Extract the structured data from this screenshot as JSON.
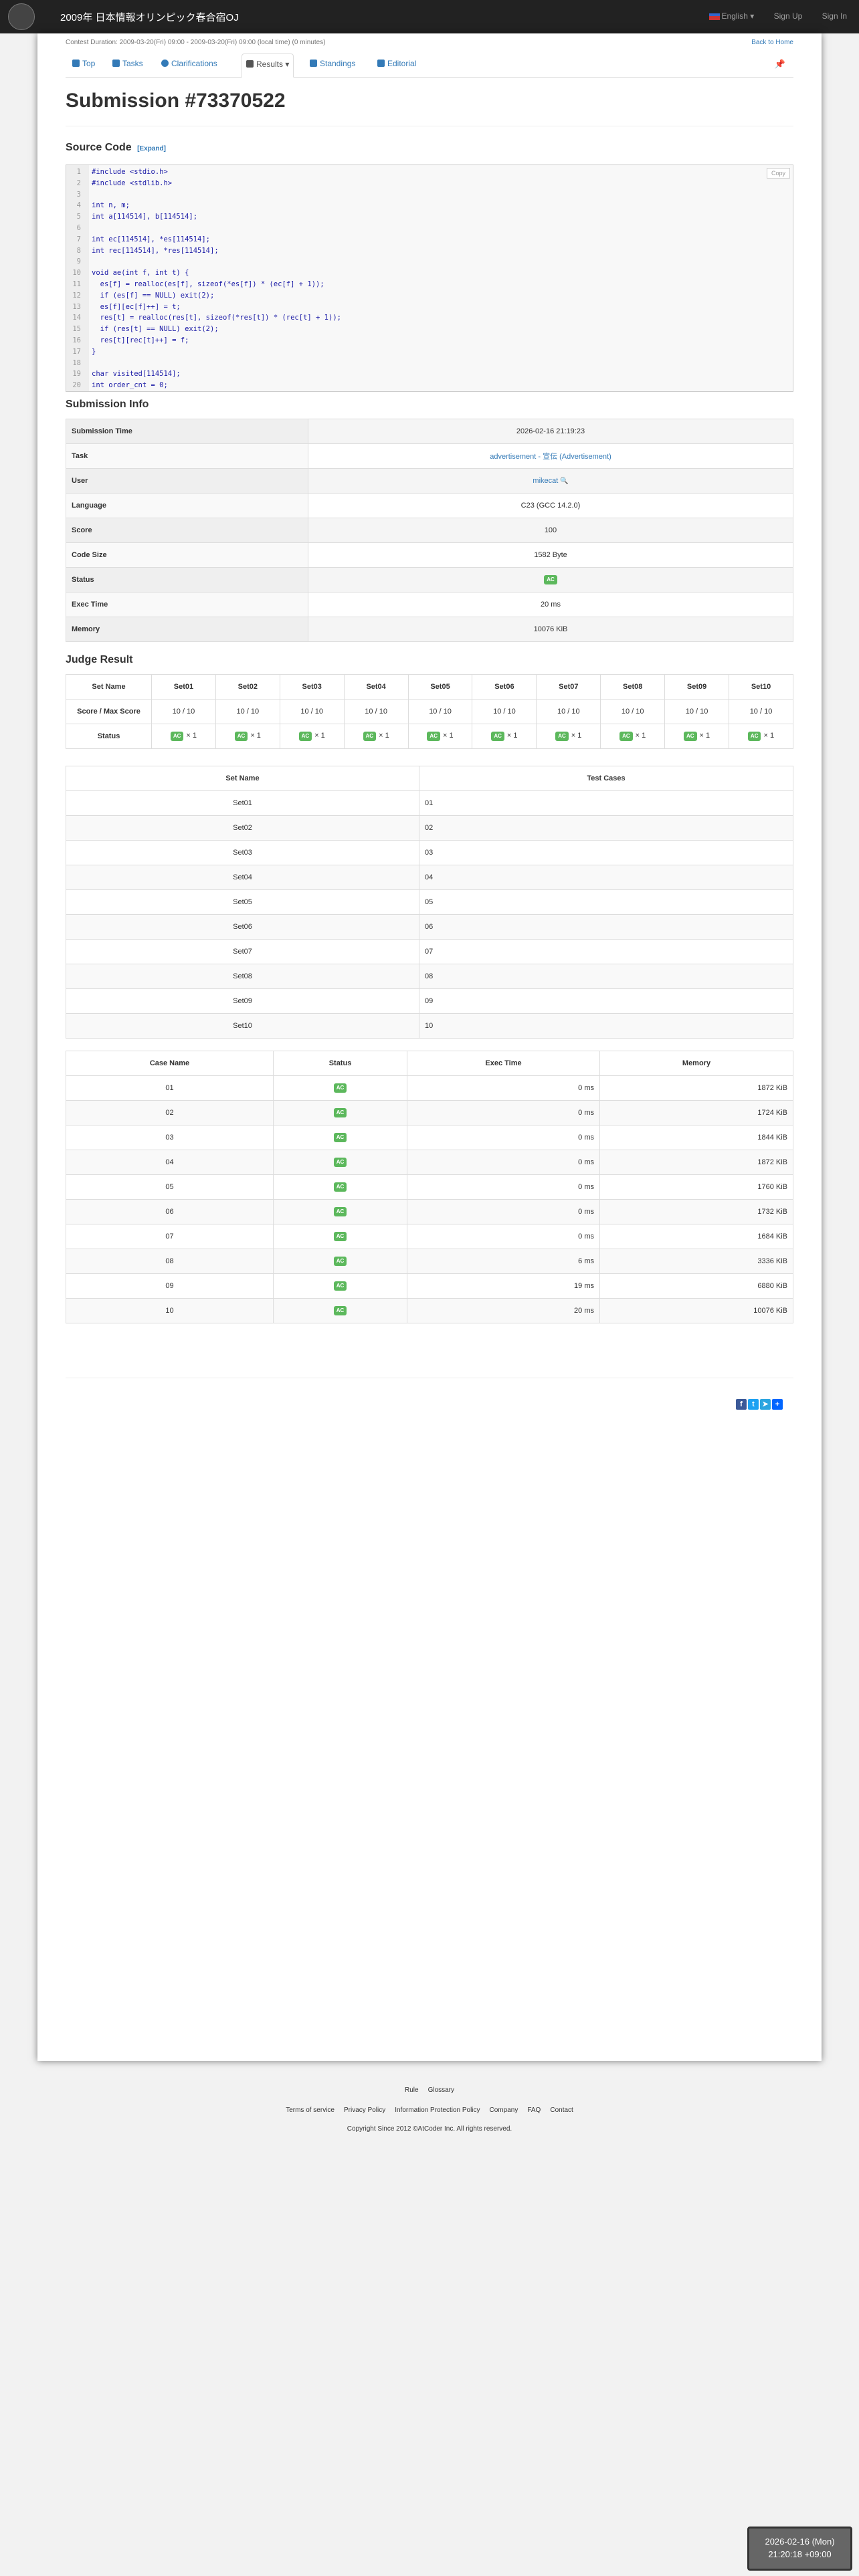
{
  "header": {
    "contest_name": "2009年 日本情報オリンピック春合宿OJ",
    "language": "English",
    "signup": "Sign Up",
    "signin": "Sign In"
  },
  "contest": {
    "duration": "Contest Duration: 2009-03-20(Fri) 09:00 - 2009-03-20(Fri) 09:00 (local time) (0 minutes)",
    "back_home": "Back to Home"
  },
  "nav": {
    "top": "Top",
    "tasks": "Tasks",
    "clarifications": "Clarifications",
    "results": "Results",
    "standings": "Standings",
    "editorial": "Editorial"
  },
  "page_title": "Submission #73370522",
  "source": {
    "heading": "Source Code",
    "expand": "[Expand]",
    "copy": "Copy",
    "lines": [
      "#include <stdio.h>",
      "#include <stdlib.h>",
      "",
      "int n, m;",
      "int a[114514], b[114514];",
      "",
      "int ec[114514], *es[114514];",
      "int rec[114514], *res[114514];",
      "",
      "void ae(int f, int t) {",
      "  es[f] = realloc(es[f], sizeof(*es[f]) * (ec[f] + 1));",
      "  if (es[f] == NULL) exit(2);",
      "  es[f][ec[f]++] = t;",
      "  res[t] = realloc(res[t], sizeof(*res[t]) * (rec[t] + 1));",
      "  if (res[t] == NULL) exit(2);",
      "  res[t][rec[t]++] = f;",
      "}",
      "",
      "char visited[114514];",
      "int order_cnt = 0;"
    ]
  },
  "info": {
    "heading": "Submission Info",
    "rows": [
      {
        "label": "Submission Time",
        "value": "2026-02-16 21:19:23"
      },
      {
        "label": "Task",
        "value": "advertisement - 宣伝 (Advertisement)"
      },
      {
        "label": "User",
        "value": "mikecat"
      },
      {
        "label": "Language",
        "value": "C23 (GCC 14.2.0)"
      },
      {
        "label": "Score",
        "value": "100"
      },
      {
        "label": "Code Size",
        "value": "1582 Byte"
      },
      {
        "label": "Status",
        "value": "AC"
      },
      {
        "label": "Exec Time",
        "value": "20 ms"
      },
      {
        "label": "Memory",
        "value": "10076 KiB"
      }
    ]
  },
  "judge": {
    "heading": "Judge Result",
    "set_name_label": "Set Name",
    "score_label": "Score / Max Score",
    "status_label": "Status",
    "sets": [
      {
        "name": "Set01",
        "score": "10 / 10",
        "status": "AC",
        "count": "× 1"
      },
      {
        "name": "Set02",
        "score": "10 / 10",
        "status": "AC",
        "count": "× 1"
      },
      {
        "name": "Set03",
        "score": "10 / 10",
        "status": "AC",
        "count": "× 1"
      },
      {
        "name": "Set04",
        "score": "10 / 10",
        "status": "AC",
        "count": "× 1"
      },
      {
        "name": "Set05",
        "score": "10 / 10",
        "status": "AC",
        "count": "× 1"
      },
      {
        "name": "Set06",
        "score": "10 / 10",
        "status": "AC",
        "count": "× 1"
      },
      {
        "name": "Set07",
        "score": "10 / 10",
        "status": "AC",
        "count": "× 1"
      },
      {
        "name": "Set08",
        "score": "10 / 10",
        "status": "AC",
        "count": "× 1"
      },
      {
        "name": "Set09",
        "score": "10 / 10",
        "status": "AC",
        "count": "× 1"
      },
      {
        "name": "Set10",
        "score": "10 / 10",
        "status": "AC",
        "count": "× 1"
      }
    ]
  },
  "set_cases": {
    "headers": [
      "Set Name",
      "Test Cases"
    ],
    "rows": [
      [
        "Set01",
        "01"
      ],
      [
        "Set02",
        "02"
      ],
      [
        "Set03",
        "03"
      ],
      [
        "Set04",
        "04"
      ],
      [
        "Set05",
        "05"
      ],
      [
        "Set06",
        "06"
      ],
      [
        "Set07",
        "07"
      ],
      [
        "Set08",
        "08"
      ],
      [
        "Set09",
        "09"
      ],
      [
        "Set10",
        "10"
      ]
    ]
  },
  "cases": {
    "headers": [
      "Case Name",
      "Status",
      "Exec Time",
      "Memory"
    ],
    "rows": [
      [
        "01",
        "AC",
        "0 ms",
        "1872 KiB"
      ],
      [
        "02",
        "AC",
        "0 ms",
        "1724 KiB"
      ],
      [
        "03",
        "AC",
        "0 ms",
        "1844 KiB"
      ],
      [
        "04",
        "AC",
        "0 ms",
        "1872 KiB"
      ],
      [
        "05",
        "AC",
        "0 ms",
        "1760 KiB"
      ],
      [
        "06",
        "AC",
        "0 ms",
        "1732 KiB"
      ],
      [
        "07",
        "AC",
        "0 ms",
        "1684 KiB"
      ],
      [
        "08",
        "AC",
        "6 ms",
        "3336 KiB"
      ],
      [
        "09",
        "AC",
        "19 ms",
        "6880 KiB"
      ],
      [
        "10",
        "AC",
        "20 ms",
        "10076 KiB"
      ]
    ]
  },
  "footer": {
    "row1": [
      "Rule",
      "Glossary"
    ],
    "row2": [
      "Terms of service",
      "Privacy Policy",
      "Information Protection Policy",
      "Company",
      "FAQ",
      "Contact"
    ],
    "copyright": "Copyright Since 2012 ©AtCoder Inc. All rights reserved."
  },
  "clock": {
    "date": "2026-02-16 (Mon)",
    "time": "21:20:18 +09:00"
  },
  "colors": {
    "ac": "#5cb85c",
    "header": "#222222",
    "link": "#337ab7"
  }
}
